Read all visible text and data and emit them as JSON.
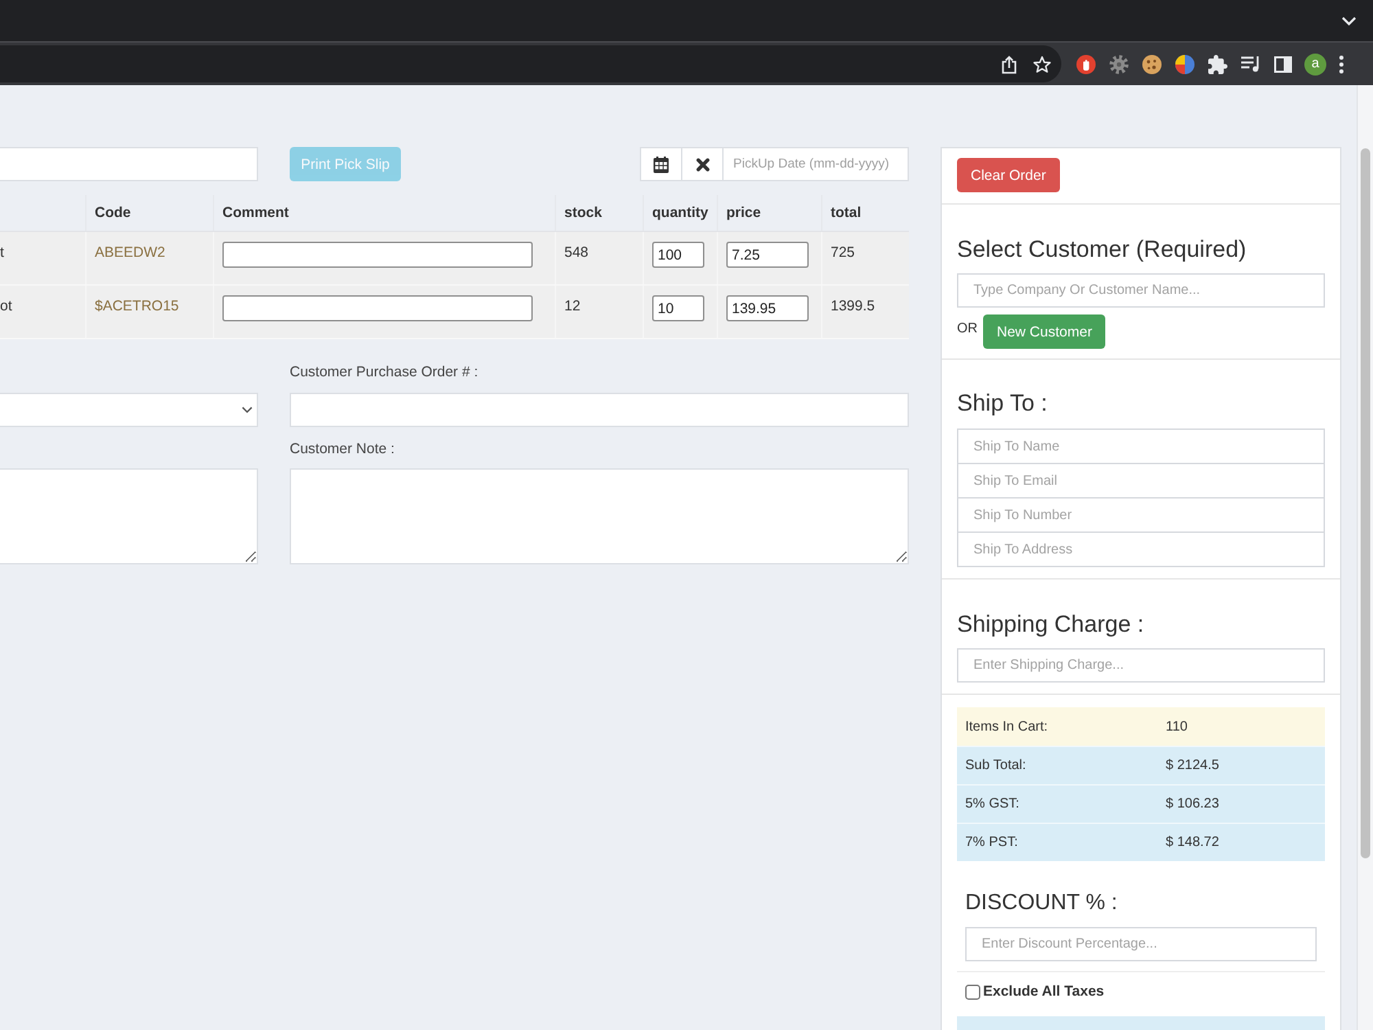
{
  "browser": {
    "profile_initial": "a"
  },
  "toolbar": {
    "print_button": {
      "label": "Print Pick Slip",
      "disabled": true
    },
    "pickup_date": {
      "placeholder": "PickUp Date (mm-dd-yyyy)"
    }
  },
  "table": {
    "columns": [
      "Code",
      "Comment",
      "stock",
      "quantity",
      "price",
      "total"
    ],
    "rows": [
      {
        "column_1": "t",
        "code": "ABEEDW2",
        "stock": "548",
        "quantity": "100",
        "price": "7.25",
        "total": "725"
      },
      {
        "column_1": "ot",
        "code": "$ACETRO15",
        "stock": "12",
        "quantity": "10",
        "price": "139.95",
        "total": "1399.5"
      }
    ]
  },
  "form": {
    "purchase_order_label": "Customer Purchase Order # :",
    "note_label": "Customer Note :"
  },
  "sidebar": {
    "clear_button": "Clear Order",
    "customer": {
      "heading": "Select Customer (Required)",
      "placeholder": "Type Company Or Customer Name...",
      "or_text": "OR",
      "new_button": "New Customer"
    },
    "ship_to": {
      "heading": "Ship To :",
      "fields": [
        {
          "placeholder": "Ship To Name"
        },
        {
          "placeholder": "Ship To Email"
        },
        {
          "placeholder": "Ship To Number"
        },
        {
          "placeholder": "Ship To Address"
        }
      ]
    },
    "shipping": {
      "heading": "Shipping Charge :",
      "placeholder": "Enter Shipping Charge..."
    },
    "summary": [
      {
        "label": "Items In Cart:",
        "value": "110",
        "kind": "warning"
      },
      {
        "label": "Sub Total:",
        "value": "$ 2124.5",
        "kind": "info"
      },
      {
        "label": "5% GST:",
        "value": "$ 106.23",
        "kind": "info"
      },
      {
        "label": "7% PST:",
        "value": "$ 148.72",
        "kind": "info"
      }
    ],
    "discount": {
      "heading": "DISCOUNT % :",
      "placeholder": "Enter Discount Percentage..."
    },
    "exclude_taxes": {
      "label": "Exclude All Taxes",
      "checked": false
    }
  }
}
